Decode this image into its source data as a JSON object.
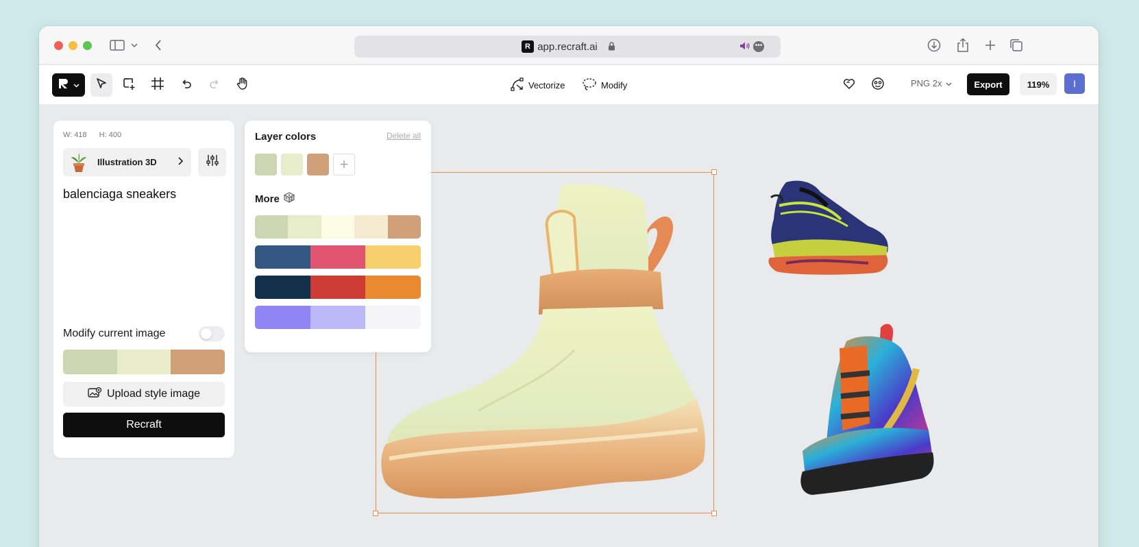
{
  "browser": {
    "url": "app.recraft.ai"
  },
  "toolbar": {
    "vectorize_label": "Vectorize",
    "modify_label": "Modify",
    "format_label": "PNG 2x",
    "export_label": "Export",
    "zoom_label": "119%",
    "avatar_initial": "I"
  },
  "left_panel": {
    "width_label": "W: 418",
    "height_label": "H: 400",
    "style_label": "Illustration 3D",
    "prompt": "balenciaga sneakers",
    "modify_label": "Modify current image",
    "modify_enabled": false,
    "palette": [
      "#cdd5b2",
      "#e8ecca",
      "#cfa07a"
    ],
    "upload_label": "Upload style image",
    "recraft_label": "Recraft"
  },
  "color_panel": {
    "title": "Layer colors",
    "delete_label": "Delete all",
    "layer_colors": [
      "#cdd5b2",
      "#e7ecca",
      "#cfa07a"
    ],
    "more_title": "More",
    "more_palettes": [
      [
        "#cdd5b2",
        "#e7ecca",
        "#fbfbe6",
        "#f6ead0",
        "#cfa07a"
      ],
      [
        "#335781",
        "#e0546f",
        "#f6d06c"
      ],
      [
        "#13304b",
        "#cc3c34",
        "#ea8a30"
      ],
      [
        "#8f86f4",
        "#bbb8f7",
        "#f5f5f8"
      ]
    ]
  },
  "colors": {
    "selection": "#ea8f52",
    "accent_black": "#0e0e0e"
  }
}
